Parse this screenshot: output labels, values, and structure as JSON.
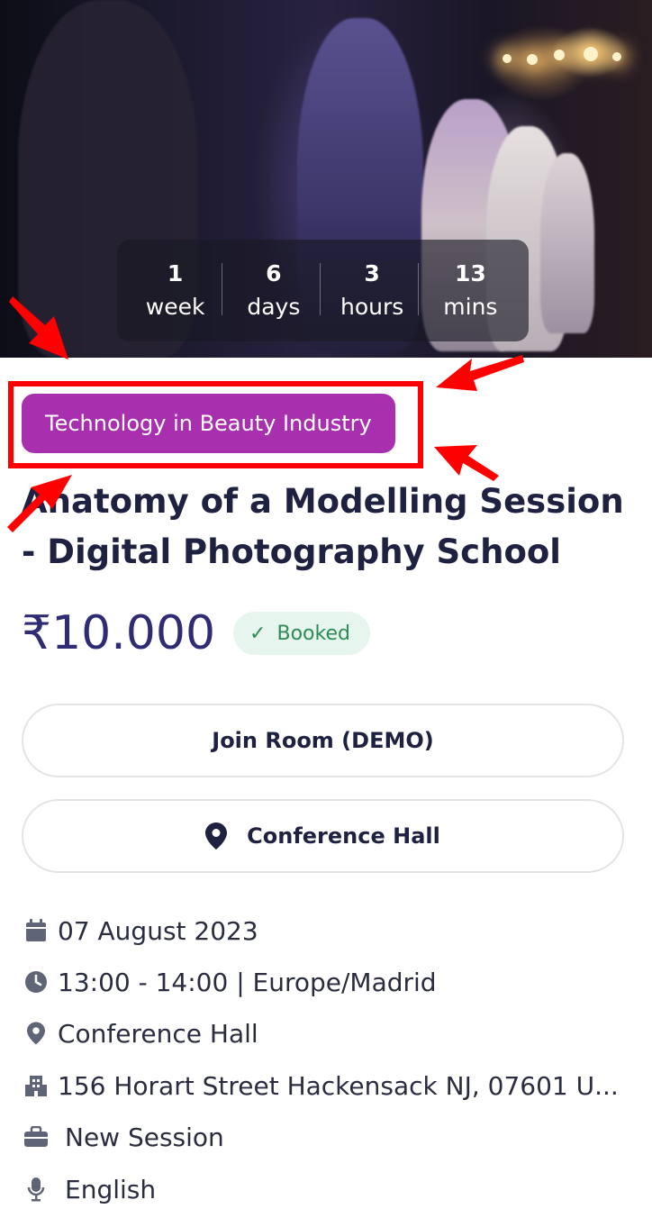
{
  "countdown": [
    {
      "value": "1",
      "unit": "week"
    },
    {
      "value": "6",
      "unit": "days"
    },
    {
      "value": "3",
      "unit": "hours"
    },
    {
      "value": "13",
      "unit": "mins"
    }
  ],
  "category": "Technology in Beauty Industry",
  "title": "Anatomy of a Modelling Session - Digital Photography School",
  "price": "₹10.000",
  "status_badge": "Booked",
  "buttons": {
    "join_room": "Join Room (DEMO)",
    "location": "Conference Hall"
  },
  "details": {
    "date": "07 August 2023",
    "time": "13:00 - 14:00 | Europe/Madrid",
    "venue": "Conference Hall",
    "address": "156 Horart Street Hackensack NJ, 07601 U...",
    "session_type": "New Session",
    "language": "English"
  },
  "colors": {
    "tag_bg": "#a82fae",
    "price": "#2f2c73",
    "booked_bg": "#e6f6ee",
    "booked_text": "#2e8b57",
    "annotation_red": "#ff0000"
  },
  "icons": [
    "calendar-icon",
    "clock-icon",
    "map-pin-icon",
    "building-icon",
    "briefcase-icon",
    "microphone-icon",
    "check-icon"
  ]
}
